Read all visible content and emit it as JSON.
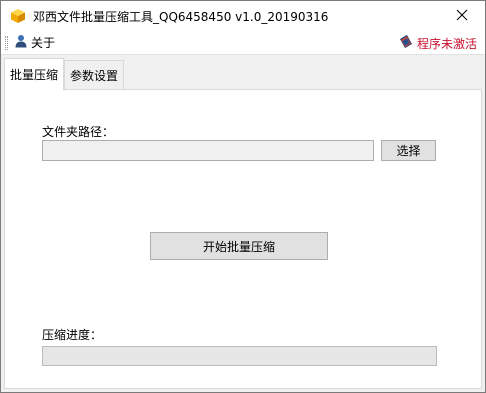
{
  "window": {
    "title": "邓西文件批量压缩工具_QQ6458450 v1.0_20190316"
  },
  "menu": {
    "about": "关于",
    "status": "程序未激活"
  },
  "tabs": [
    {
      "label": "批量压缩",
      "active": true
    },
    {
      "label": "参数设置",
      "active": false
    }
  ],
  "main": {
    "folder_label": "文件夹路径：",
    "folder_value": "",
    "browse_button": "选择",
    "start_button": "开始批量压缩",
    "progress_label": "压缩进度：",
    "progress_value": 0
  },
  "icons": {
    "app": "app-box-icon",
    "close": "close-icon",
    "about": "user-icon",
    "status": "book-icon"
  },
  "colors": {
    "status_text": "#c8102e",
    "app_icon": "#f5b400"
  }
}
